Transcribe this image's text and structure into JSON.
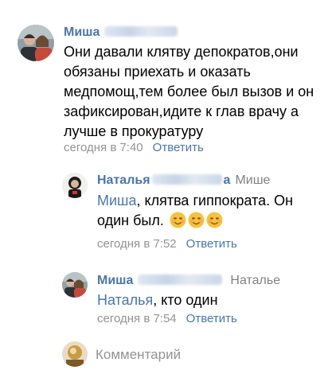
{
  "comments": [
    {
      "author": "Миша",
      "reply_to": "",
      "mention": "",
      "text": "Они давали клятву депократов,они обязаны приехать и оказать медпомощ,тем более был вызов и он зафиксирован,идите к глав врачу а лучше в прокуратуру",
      "time": "сегодня в 7:40",
      "reply_label": "Ответить",
      "avatar_icon": "couple-photo-avatar",
      "name_obscured": true
    },
    {
      "author": "Наталья",
      "author_tail": "а",
      "reply_to": "Мише",
      "mention": "Миша",
      "text": ", клятва гиппократа. Он один был.",
      "emoji": [
        "smiling-face-icon",
        "smiling-face-icon",
        "smiling-face-icon"
      ],
      "time": "сегодня в 7:52",
      "reply_label": "Ответить",
      "avatar_icon": "portrait-photo-avatar",
      "name_obscured": true
    },
    {
      "author": "Миша",
      "reply_to": "Наталье",
      "mention": "Наталья",
      "text": ", кто один",
      "time": "сегодня в 7:54",
      "reply_label": "Ответить",
      "avatar_icon": "couple-photo-avatar",
      "name_obscured": true
    }
  ],
  "composer": {
    "placeholder": "Комментарий",
    "avatar_icon": "current-user-avatar"
  },
  "colors": {
    "link": "#4a76a8",
    "meta": "#939393",
    "text": "#000000",
    "background": "#ffffff"
  }
}
